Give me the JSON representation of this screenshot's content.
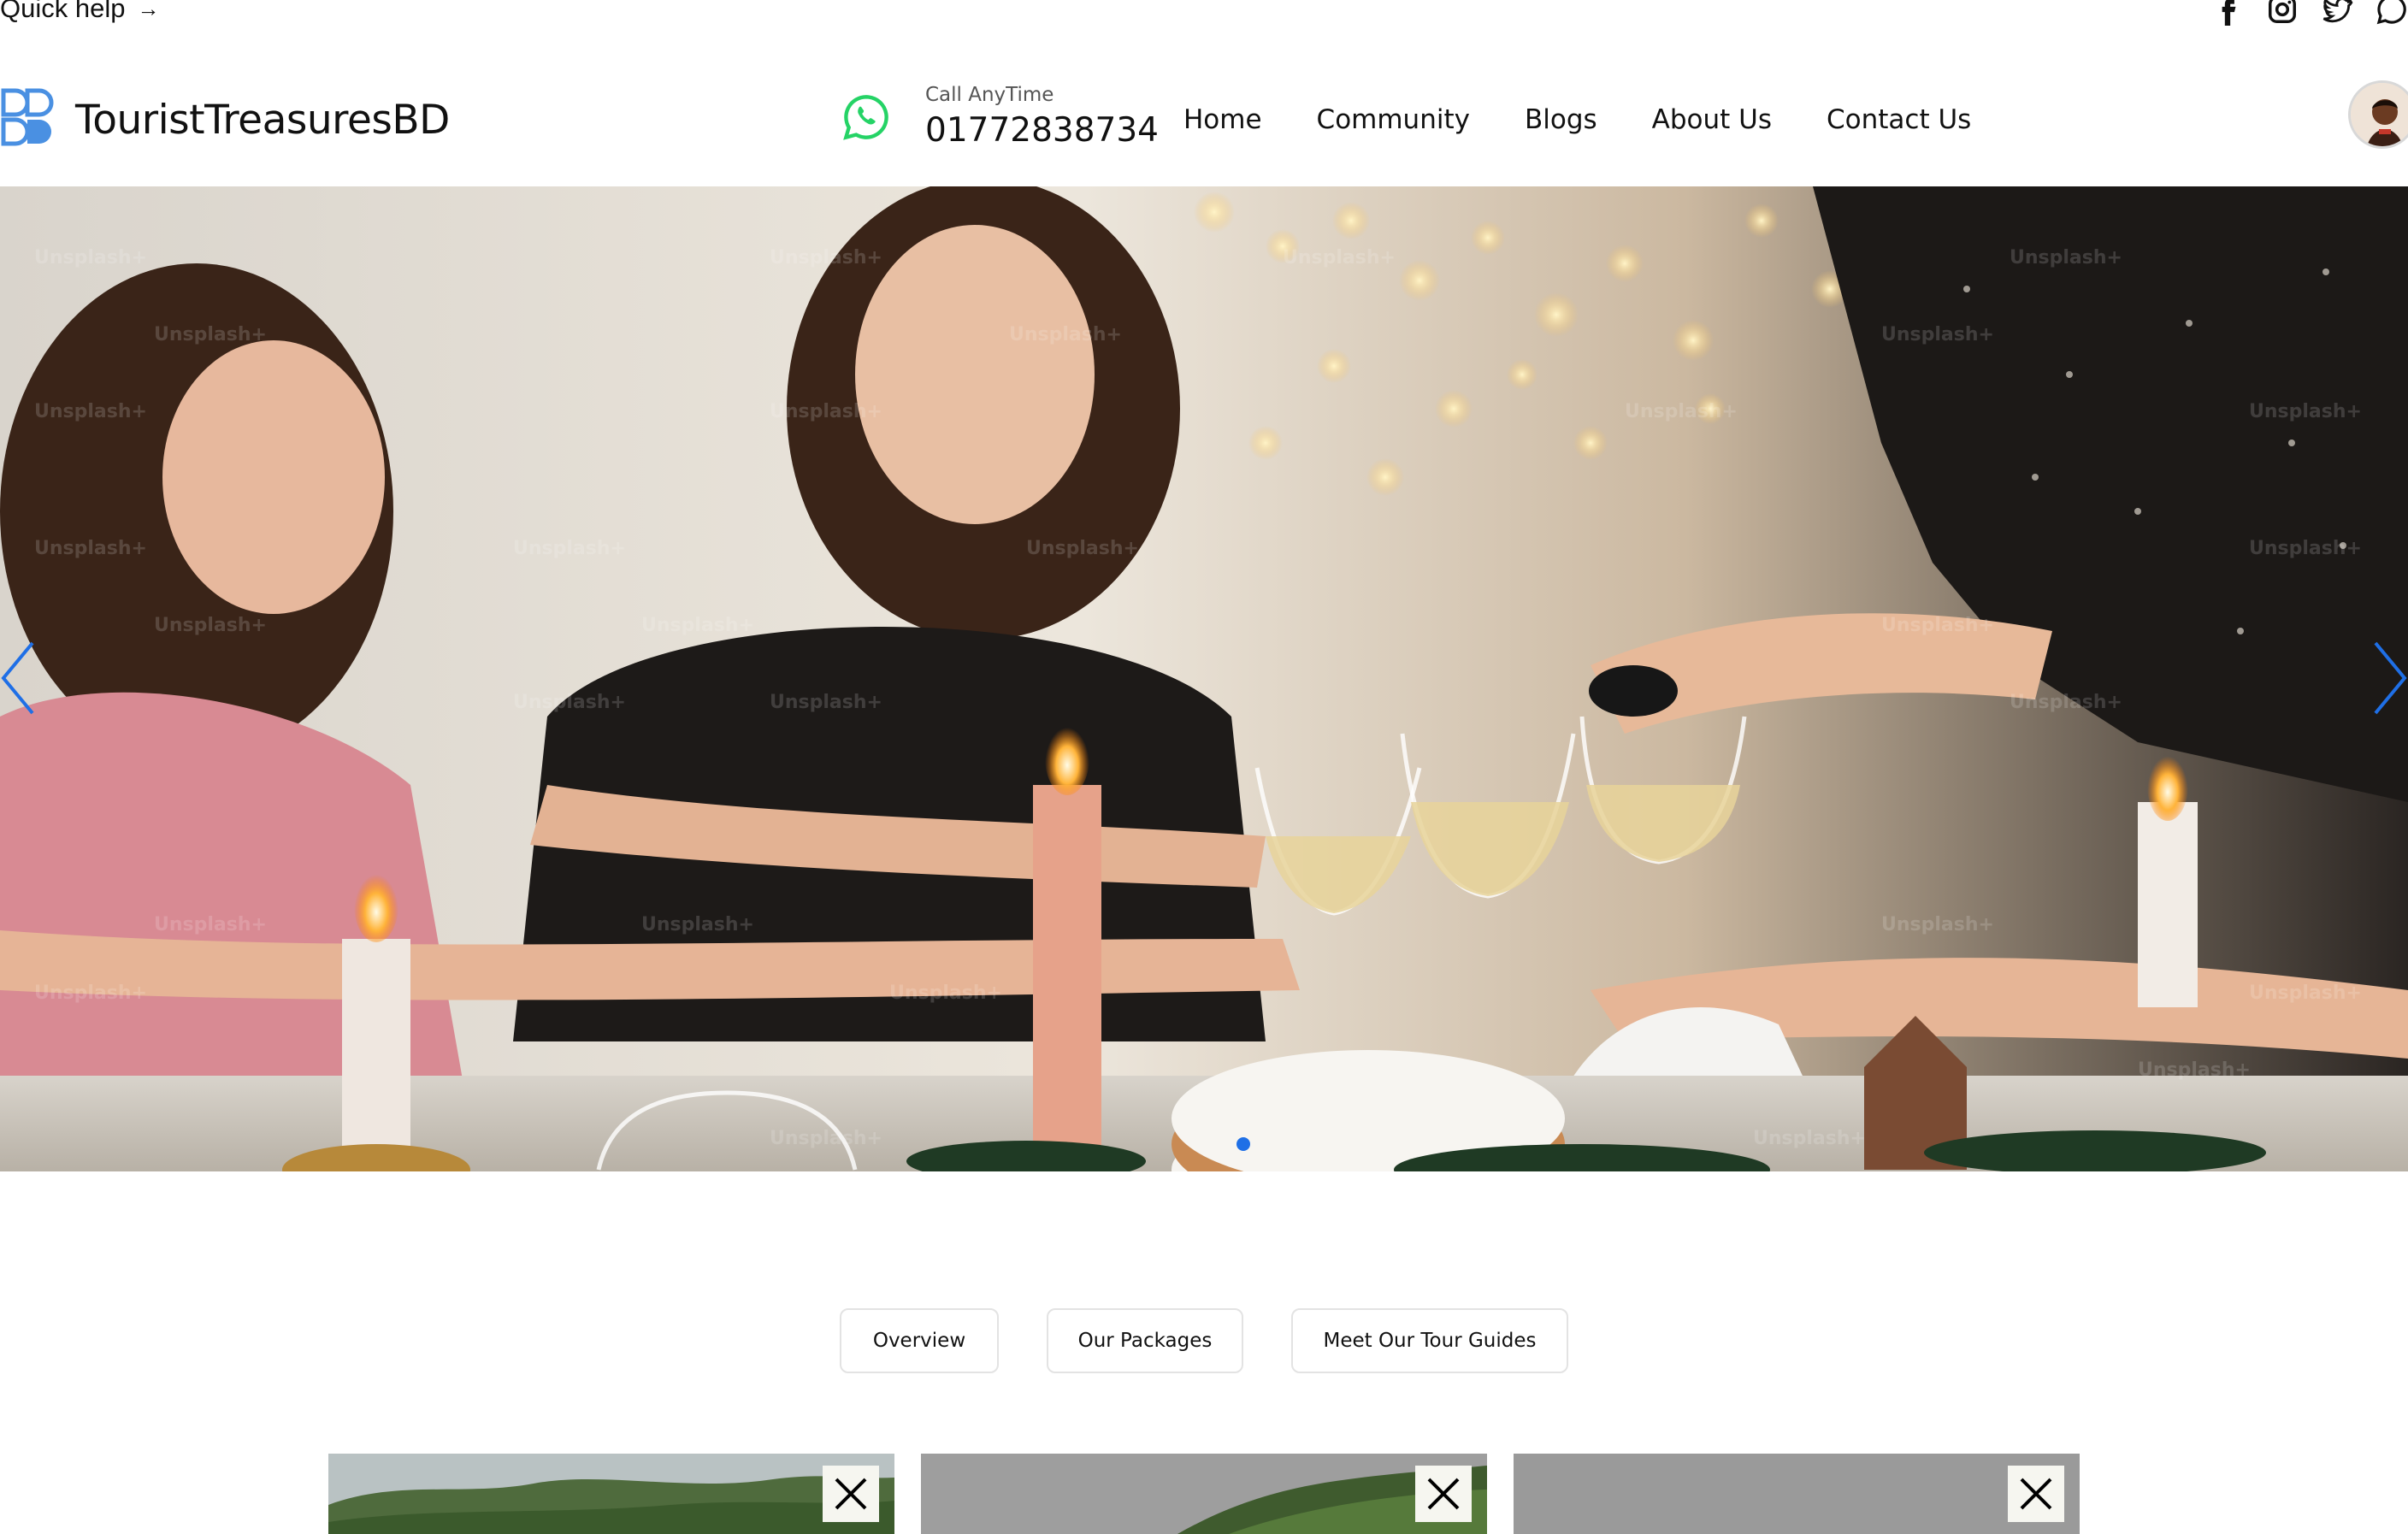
{
  "topbar": {
    "quick_help": "Quick help",
    "quick_help_arrow": "→",
    "socials": [
      "facebook-icon",
      "instagram-icon",
      "twitter-icon",
      "whatsapp-icon"
    ]
  },
  "header": {
    "logo_text": "TouristTreasuresBD",
    "call_label": "Call AnyTime",
    "call_number": "01772838734",
    "nav": [
      "Home",
      "Community",
      "Blogs",
      "About Us",
      "Contact Us"
    ]
  },
  "hero": {
    "image": "friends toasting with wine glasses at candlelit dinner table",
    "active_slide": 1
  },
  "tabs": [
    "Overview",
    "Our Packages",
    "Meet Our Tour Guides"
  ],
  "cards": [
    {
      "image": "green hills landscape",
      "close_icon": "close-icon"
    },
    {
      "image": "tea garden hills",
      "close_icon": "close-icon"
    },
    {
      "image": "grey placeholder",
      "close_icon": "close-icon"
    }
  ],
  "colors": {
    "accent": "#1f6fe6",
    "whatsapp": "#25d366",
    "logo_blue": "#4a90e2"
  }
}
